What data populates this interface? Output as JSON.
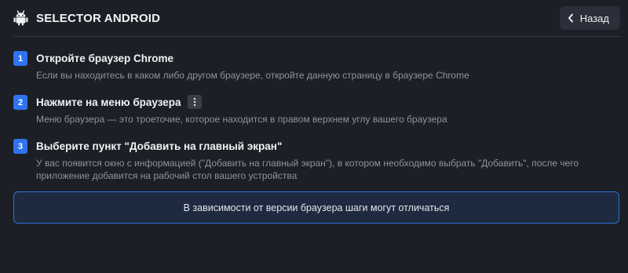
{
  "header": {
    "title": "SELECTOR ANDROID",
    "back_label": "Назад",
    "logo_icon": "android-icon",
    "back_icon": "chevron-left-icon"
  },
  "steps": [
    {
      "number": "1",
      "title": "Откройте браузер Chrome",
      "description": "Если вы находитесь в каком либо другом браузере, откройте данную страницу в браузере Chrome"
    },
    {
      "number": "2",
      "title": "Нажмите на меню браузера",
      "icon": "kebab-menu-icon",
      "description": "Меню браузера — это троеточие, которое находится в правом верхнем углу вашего браузера"
    },
    {
      "number": "3",
      "title": "Выберите пункт \"Добавить на главный экран\"",
      "description": "У вас появится окно с информацией (\"Добавить на главный экран\"), в котором необходимо выбрать \"Добавить\", после чего приложение добавится на рабочий стол вашего устройства"
    }
  ],
  "notice": {
    "text": "В зависимости от версии браузера шаги могут отличаться"
  },
  "colors": {
    "background": "#1c1f26",
    "accent": "#2f73f0",
    "notice_border": "#2f6fd6"
  }
}
